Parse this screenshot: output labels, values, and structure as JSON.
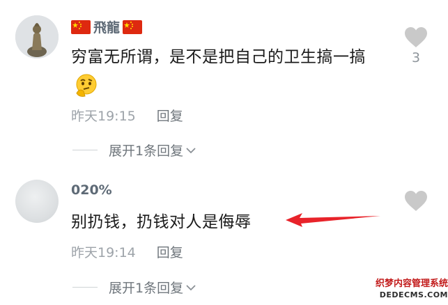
{
  "comments": [
    {
      "username": "飛龍",
      "text": "穷富无所谓，是不是把自己的卫生搞一搞",
      "timestamp": "昨天19:15",
      "reply_label": "回复",
      "expand_label": "展开1条回复",
      "like_count": "3"
    },
    {
      "username": "020%",
      "text": "别扔钱，扔钱对人是侮辱",
      "timestamp": "昨天19:14",
      "reply_label": "回复",
      "expand_label": "展开1条回复"
    }
  ],
  "watermark": {
    "line1": "织梦内容管理系统",
    "line2": "DEDECMS.COM"
  },
  "colors": {
    "username": "#5e6a76",
    "meta": "#9da3a9",
    "heart": "#c9c9c9",
    "arrow": "#e8232a"
  },
  "icons": [
    "china-flag-icon",
    "thinking-emoji-icon",
    "heart-icon",
    "chevron-down-icon",
    "red-arrow-annotation"
  ]
}
